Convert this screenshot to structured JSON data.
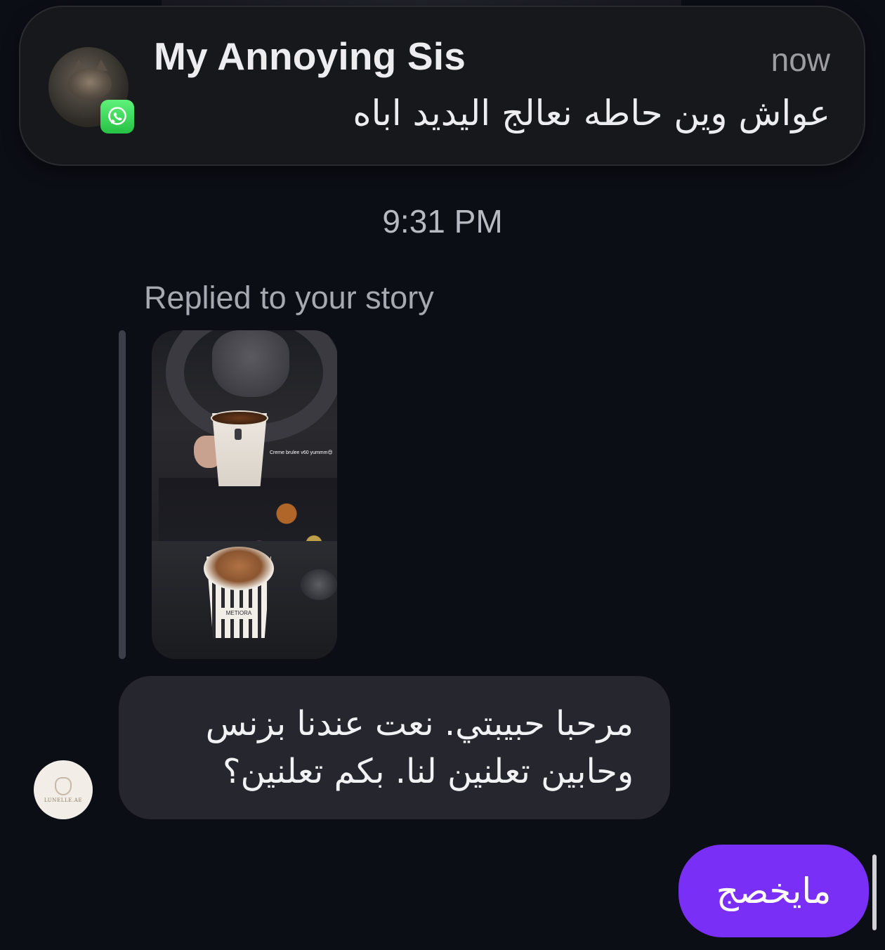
{
  "notification": {
    "sender": "My Annoying Sis",
    "time": "now",
    "message": "عواش وين حاطه نعالج اليديد اباه",
    "app_icon": "whatsapp-icon",
    "avatar": "cat-photo"
  },
  "conversation": {
    "timestamp": "9:31 PM",
    "reply_label": "Replied to your story",
    "story": {
      "caption": "Creme brulee v60 yummm😍",
      "cup_label": "METIORA"
    },
    "incoming": {
      "avatar_brand": "LUNELLE.AE",
      "text": "مرحبا حبيبتي. نعت عندنا بزنس وحابين تعلنين لنا. بكم تعلنين؟"
    },
    "outgoing": {
      "text": "مايخصج"
    }
  },
  "colors": {
    "background": "#0c0e16",
    "incoming_bubble": "#26272e",
    "outgoing_bubble": "#7a2ff7",
    "whatsapp_green": "#25c244"
  }
}
